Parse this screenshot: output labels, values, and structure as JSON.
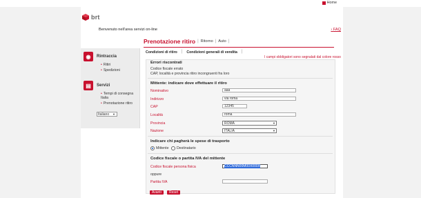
{
  "header": {
    "home_label": "Home",
    "brand": "brt",
    "welcome": "Benvenuto  nell'area servizi on-line",
    "faq": "FAQ"
  },
  "sidebar": {
    "groups": [
      {
        "title": "Rintraccia",
        "items": [
          "Ritiri",
          "Spedizioni"
        ]
      },
      {
        "title": "Servizi",
        "items": [
          "Tempi di consegna Italia",
          "Prenotazione ritiro"
        ]
      }
    ],
    "language": "Italiano"
  },
  "main": {
    "title": "Prenotazione ritiro",
    "subnav": [
      "Ritorno",
      "Auto"
    ],
    "tabs": [
      "Condizioni di ritiro",
      "Condizioni generali di vendita"
    ],
    "required_note": "I campi obbligatori sono segnalati dal colore rosso",
    "errors": {
      "title": "Errori riscontrati",
      "lines": [
        "Codice fiscale errato",
        "CAP, località e provincia ritiro incongruenti fra loro"
      ]
    },
    "pickup": {
      "title": "Mittente: indicare dove effettuare il ritiro",
      "fields": {
        "nominativo_label": "Nominativo",
        "nominativo_value": "aaa",
        "indirizzo_label": "Indirizzo",
        "indirizzo_value": "via roma",
        "cap_label": "CAP",
        "cap_value": "12345",
        "localita_label": "Località",
        "localita_value": "roma",
        "provincia_label": "Provincia",
        "provincia_value": "ROMA",
        "nazione_label": "Nazione",
        "nazione_value": "ITALIA"
      }
    },
    "payer": {
      "title": "Indicare chi pagherà le spese di trasporto",
      "options": [
        "Mittente",
        "Destinatario"
      ],
      "selected": "Mittente"
    },
    "tax": {
      "title": "Codice fiscale o partita IVA del mittente",
      "cf_label": "Codice fiscale persona fisica",
      "cf_value": "CCCNNN00M00X000X",
      "oppure": "oppure",
      "piva_label": "Partita IVA",
      "piva_value": ""
    },
    "buttons": {
      "next": "Avanti",
      "reset": "Reset"
    }
  },
  "colors": {
    "accent": "#c8102e",
    "selection": "#2f6ad9"
  }
}
